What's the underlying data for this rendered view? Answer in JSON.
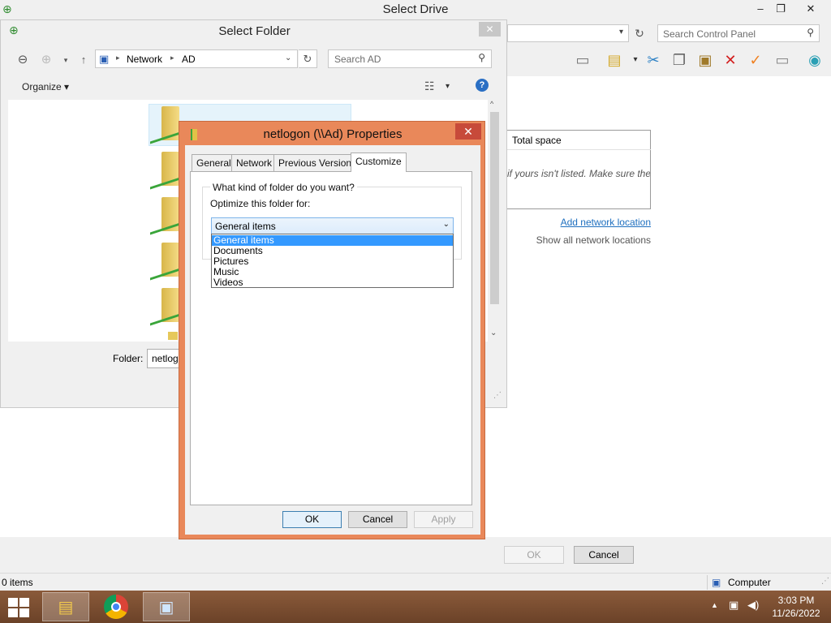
{
  "drive_window": {
    "title": "Select Drive",
    "controls": {
      "minimize": "–",
      "restore": "❐",
      "close": "✕"
    },
    "search_placeholder": "Search Control Panel",
    "list_column": "Total space",
    "list_hint": "if yours isn't listed. Make sure the",
    "add_network_location": "Add network location",
    "show_all_network_locations": "Show all network locations",
    "ok": "OK",
    "cancel": "Cancel",
    "status_items": "0 items",
    "status_computer": "Computer"
  },
  "folder_dialog": {
    "title": "Select Folder",
    "close": "✕",
    "breadcrumb": [
      "Network",
      "AD"
    ],
    "search_placeholder": "Search AD",
    "organize": "Organize ▾",
    "folder_label": "Folder:",
    "folder_value": "netlogon"
  },
  "properties_dialog": {
    "title": "netlogon (\\\\Ad) Properties",
    "tabs": [
      "General",
      "Network",
      "Previous Versions",
      "Customize"
    ],
    "active_tab": "Customize",
    "question": "What kind of folder do you want?",
    "optimize_label": "Optimize this folder for:",
    "selected": "General items",
    "options": [
      "General items",
      "Documents",
      "Pictures",
      "Music",
      "Videos"
    ],
    "ok": "OK",
    "cancel": "Cancel",
    "apply": "Apply"
  },
  "taskbar": {
    "time": "3:03 PM",
    "date": "11/26/2022"
  },
  "colors": {
    "accent_dialog_border": "#e9885a",
    "selection": "#3399ff",
    "link": "#1e6fbf",
    "taskbar": "#6b4228"
  }
}
